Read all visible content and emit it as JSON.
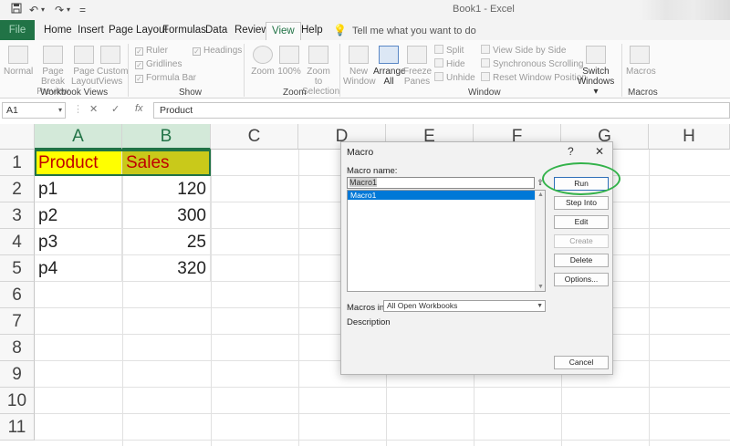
{
  "titlebar": {
    "title": "Book1  -  Excel",
    "save_icon": "save-icon",
    "undo_icon": "undo-icon",
    "redo_icon": "redo-icon",
    "qa_more": "="
  },
  "menu": {
    "tabs": [
      "File",
      "Home",
      "Insert",
      "Page Layout",
      "Formulas",
      "Data",
      "Review",
      "View",
      "Help"
    ],
    "active": "View",
    "tell_me": "Tell me what you want to do"
  },
  "ribbon": {
    "workbook_views": {
      "label": "Workbook Views",
      "buttons": [
        "Normal",
        "Page Break Preview",
        "Page Layout",
        "Custom Views"
      ]
    },
    "show": {
      "label": "Show",
      "checks": [
        {
          "label": "Ruler",
          "checked": true
        },
        {
          "label": "Gridlines",
          "checked": true
        },
        {
          "label": "Formula Bar",
          "checked": true
        },
        {
          "label": "Headings",
          "checked": true
        }
      ]
    },
    "zoom": {
      "label": "Zoom",
      "buttons": [
        "Zoom",
        "100%",
        "Zoom to Selection"
      ]
    },
    "window": {
      "label": "Window",
      "buttons": [
        "New Window",
        "Arrange All",
        "Freeze Panes"
      ],
      "small": [
        "Split",
        "Hide",
        "Unhide",
        "View Side by Side",
        "Synchronous Scrolling",
        "Reset Window Position"
      ],
      "switch": "Switch Windows"
    },
    "macros": {
      "label": "Macros",
      "button": "Macros"
    }
  },
  "formula_bar": {
    "name_box": "A1",
    "cancel": "✕",
    "enter": "✓",
    "fx": "fx",
    "content": "Product"
  },
  "sheet": {
    "columns": [
      "A",
      "B",
      "C",
      "D",
      "E",
      "F",
      "G",
      "H"
    ],
    "rows": [
      "1",
      "2",
      "3",
      "4",
      "5",
      "6",
      "7",
      "8",
      "9",
      "10",
      "11"
    ],
    "cells": {
      "A1": "Product",
      "B1": "Sales",
      "A2": "p1",
      "B2": "120",
      "A3": "p2",
      "B3": "300",
      "A4": "p3",
      "B4": "25",
      "A5": "p4",
      "B5": "320"
    }
  },
  "dialog": {
    "title": "Macro",
    "help": "?",
    "close": "✕",
    "macro_name_label": "Macro name:",
    "macro_name_value": "Macro1",
    "list": [
      "Macro1"
    ],
    "buttons": {
      "run": "Run",
      "step_into": "Step Into",
      "edit": "Edit",
      "create": "Create",
      "delete": "Delete",
      "options": "Options...",
      "cancel": "Cancel"
    },
    "macros_in_label": "Macros in:",
    "macros_in_value": "All Open Workbooks",
    "description_label": "Description"
  }
}
